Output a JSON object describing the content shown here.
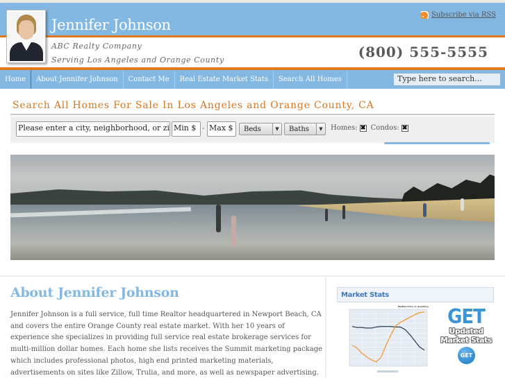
{
  "header": {
    "site_name": "Jennifer Johnson",
    "company": "ABC Realty Company",
    "tagline": "Serving Los Angeles and Orange County",
    "phone": "(800) 555-5555",
    "rss_label": "Subscribe via RSS"
  },
  "nav": {
    "items": [
      {
        "label": "Home"
      },
      {
        "label": "About Jennifer Johnson"
      },
      {
        "label": "Contact Me"
      },
      {
        "label": "Real Estate Market Stats"
      },
      {
        "label": "Search All Homes"
      }
    ],
    "search_placeholder": "Type here to search..."
  },
  "search": {
    "title": "Search All Homes For Sale In Los Angeles and Orange County, CA",
    "city_placeholder": "Please enter a city, neighborhood, or zip code",
    "min_placeholder": "Min $",
    "max_placeholder": "Max $",
    "separator": "-",
    "beds_label": "Beds",
    "baths_label": "Baths",
    "homes_label": "Homes:",
    "condos_label": "Condos:",
    "homes_checked": true,
    "condos_checked": true,
    "check_mark": "✖"
  },
  "about": {
    "title": "About Jennifer Johnson",
    "body": "Jennifer Johnson is a full service, full time Realtor headquartered in Newport Beach, CA and covers the entire Orange County real estate market.  With her 10 years of experience she specializes in providing full service real estate brokerage services for multi-million dollar homes.  Each home she lists receives the Summit marketing package which includes professional photos, high end printed marketing materials, advertisements on sites like Zillow, Trulia, and more, as well as newspaper advertising."
  },
  "sidebar": {
    "market_stats_title": "Market Stats",
    "promo_big": "GET",
    "promo_line1": "Updated",
    "promo_line2": "Market Stats",
    "promo_button": "GET"
  },
  "colors": {
    "header_blue": "#83b8e3",
    "accent_orange": "#e07a1f",
    "title_orange": "#d9751e",
    "link_blue": "#3f7ab8"
  },
  "chart_data": {
    "type": "line",
    "title": "Median Price vs Inventory",
    "series": [
      {
        "name": "Median Price",
        "color": "#3d4f63",
        "values": [
          0.72,
          0.7,
          0.7,
          0.69,
          0.69,
          0.71,
          0.72,
          0.72,
          0.72,
          0.71,
          0.71,
          0.66,
          0.56,
          0.44,
          0.32,
          0.26
        ]
      },
      {
        "name": "Inventory",
        "color": "#f0a045",
        "values": [
          0.35,
          0.3,
          0.2,
          0.13,
          0.07,
          0.03,
          0.12,
          0.35,
          0.55,
          0.73,
          0.8,
          0.85,
          0.9,
          0.95,
          0.99,
          1.0
        ]
      }
    ],
    "ylim": [
      0,
      1
    ],
    "grid": true
  }
}
